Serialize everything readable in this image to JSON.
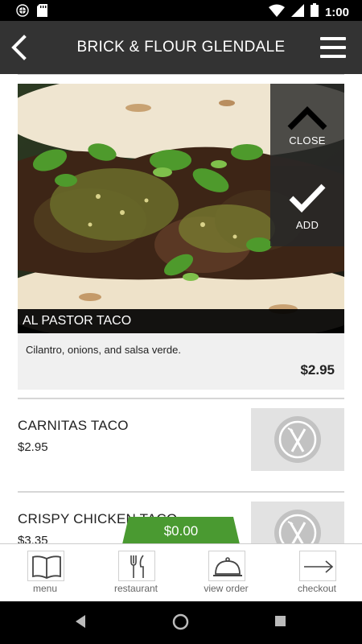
{
  "status_bar": {
    "time": "1:00",
    "left_icons": [
      "notification-icon",
      "sd-card-icon"
    ],
    "right_icons": [
      "wifi-icon",
      "cell-signal-icon",
      "battery-icon"
    ]
  },
  "header": {
    "title": "BRICK & FLOUR GLENDALE",
    "back_icon": "back-chevron-icon",
    "menu_icon": "hamburger-icon",
    "background": "#333333"
  },
  "featured_item": {
    "name": "AL PASTOR TACO",
    "description": "Cilantro, onions, and salsa verde.",
    "price": "$2.95",
    "close_label": "CLOSE",
    "add_label": "ADD"
  },
  "menu_items": [
    {
      "name": "CARNITAS TACO",
      "price": "$2.95",
      "thumb_icon": "fork-knife-icon"
    },
    {
      "name": "CRISPY CHICKEN TACO",
      "price": "$3.35",
      "thumb_icon": "fork-knife-icon"
    }
  ],
  "cart": {
    "total": "$0.00",
    "color": "#4a9a31"
  },
  "bottom_nav": [
    {
      "label": "menu",
      "icon": "book-icon"
    },
    {
      "label": "restaurant",
      "icon": "utensils-icon"
    },
    {
      "label": "view order",
      "icon": "cloche-icon"
    },
    {
      "label": "checkout",
      "icon": "arrow-right-icon"
    }
  ],
  "android_nav": {
    "buttons": [
      "back-triangle-icon",
      "home-circle-icon",
      "recents-square-icon"
    ]
  }
}
